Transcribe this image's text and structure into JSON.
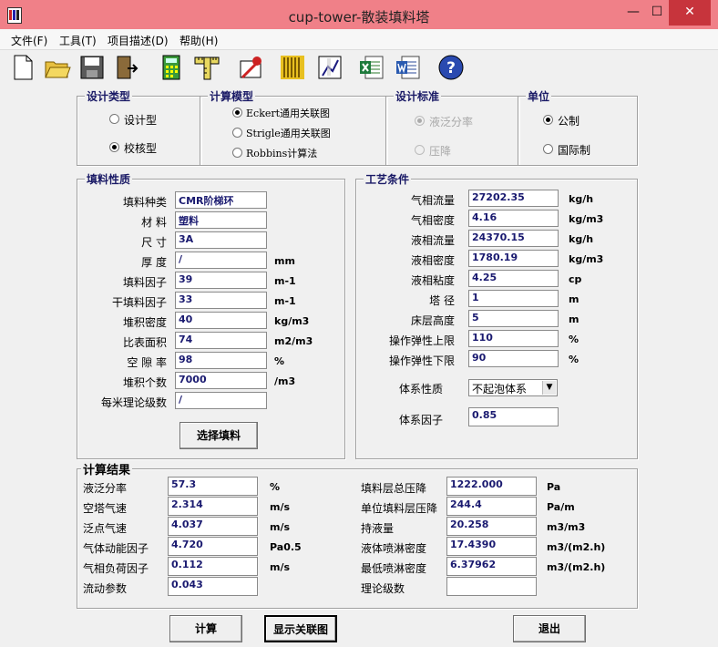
{
  "window": {
    "title": "cup-tower-散装填料塔",
    "minimize": "—",
    "maximize": "☐",
    "close": "✕"
  },
  "menu": [
    "文件(F)",
    "工具(T)",
    "项目描述(D)",
    "帮助(H)"
  ],
  "toolbar_icons": [
    "new-file-icon",
    "open-folder-icon",
    "save-disk-icon",
    "exit-door-icon",
    "calculator-icon",
    "ruler-icon",
    "tools-icon",
    "packing-icon",
    "chart-icon",
    "excel-icon",
    "word-icon",
    "help-icon"
  ],
  "design_type": {
    "label": "设计类型",
    "options": [
      "设计型",
      "校核型"
    ],
    "selected": 1
  },
  "calc_model": {
    "label": "计算模型",
    "options": [
      "Eckert通用关联图",
      "Strigle通用关联图",
      "Robbins计算法"
    ],
    "selected": 0
  },
  "design_standard": {
    "label": "设计标准",
    "options": [
      "液泛分率",
      "压降"
    ],
    "selected": 0
  },
  "units": {
    "label": "单位",
    "options": [
      "公制",
      "国际制"
    ],
    "selected": 0
  },
  "packing": {
    "label": "填料性质",
    "rows": [
      {
        "label": "填料种类",
        "value": "CMR阶梯环",
        "unit": ""
      },
      {
        "label": "材    料",
        "value": "塑料",
        "unit": ""
      },
      {
        "label": "尺    寸",
        "value": "3A",
        "unit": ""
      },
      {
        "label": "厚    度",
        "value": "/",
        "unit": "mm"
      },
      {
        "label": "填料因子",
        "value": "39",
        "unit": "m-1"
      },
      {
        "label": "干填料因子",
        "value": "33",
        "unit": "m-1"
      },
      {
        "label": "堆积密度",
        "value": "40",
        "unit": "kg/m3"
      },
      {
        "label": "比表面积",
        "value": "74",
        "unit": "m2/m3"
      },
      {
        "label": "空 隙 率",
        "value": "98",
        "unit": "%"
      },
      {
        "label": "堆积个数",
        "value": "7000",
        "unit": "/m3"
      },
      {
        "label": "每米理论级数",
        "value": "/",
        "unit": ""
      }
    ],
    "select_button": "选择填料"
  },
  "process": {
    "label": "工艺条件",
    "rows": [
      {
        "label": "气相流量",
        "value": "27202.35",
        "unit": "kg/h"
      },
      {
        "label": "气相密度",
        "value": "4.16",
        "unit": "kg/m3"
      },
      {
        "label": "液相流量",
        "value": "24370.15",
        "unit": "kg/h"
      },
      {
        "label": "液相密度",
        "value": "1780.19",
        "unit": "kg/m3"
      },
      {
        "label": "液相粘度",
        "value": "4.25",
        "unit": "cp"
      },
      {
        "label": "塔    径",
        "value": "1",
        "unit": "m"
      },
      {
        "label": "床层高度",
        "value": "5",
        "unit": "m"
      },
      {
        "label": "操作弹性上限",
        "value": "110",
        "unit": "%"
      },
      {
        "label": "操作弹性下限",
        "value": "90",
        "unit": "%"
      }
    ],
    "system_label": "体系性质",
    "system_value": "不起泡体系",
    "factor_label": "体系因子",
    "factor_value": "0.85"
  },
  "results": {
    "label": "计算结果",
    "left": [
      {
        "label": "液泛分率",
        "value": "57.3",
        "unit": "%"
      },
      {
        "label": "空塔气速",
        "value": "2.314",
        "unit": "m/s"
      },
      {
        "label": "泛点气速",
        "value": "4.037",
        "unit": "m/s"
      },
      {
        "label": "气体动能因子",
        "value": "4.720",
        "unit": "Pa0.5"
      },
      {
        "label": "气相负荷因子",
        "value": "0.112",
        "unit": "m/s"
      },
      {
        "label": "流动参数",
        "value": "0.043",
        "unit": ""
      }
    ],
    "right": [
      {
        "label": "填料层总压降",
        "value": "1222.000",
        "unit": "Pa"
      },
      {
        "label": "单位填料层压降",
        "value": "244.4",
        "unit": "Pa/m"
      },
      {
        "label": "持液量",
        "value": "20.258",
        "unit": "m3/m3"
      },
      {
        "label": "液体喷淋密度",
        "value": "17.4390",
        "unit": "m3/(m2.h)"
      },
      {
        "label": "最低喷淋密度",
        "value": "6.37962",
        "unit": "m3/(m2.h)"
      },
      {
        "label": "理论级数",
        "value": "",
        "unit": ""
      }
    ]
  },
  "buttons": {
    "calculate": "计算",
    "show_chart": "显示关联图",
    "exit": "退出"
  }
}
